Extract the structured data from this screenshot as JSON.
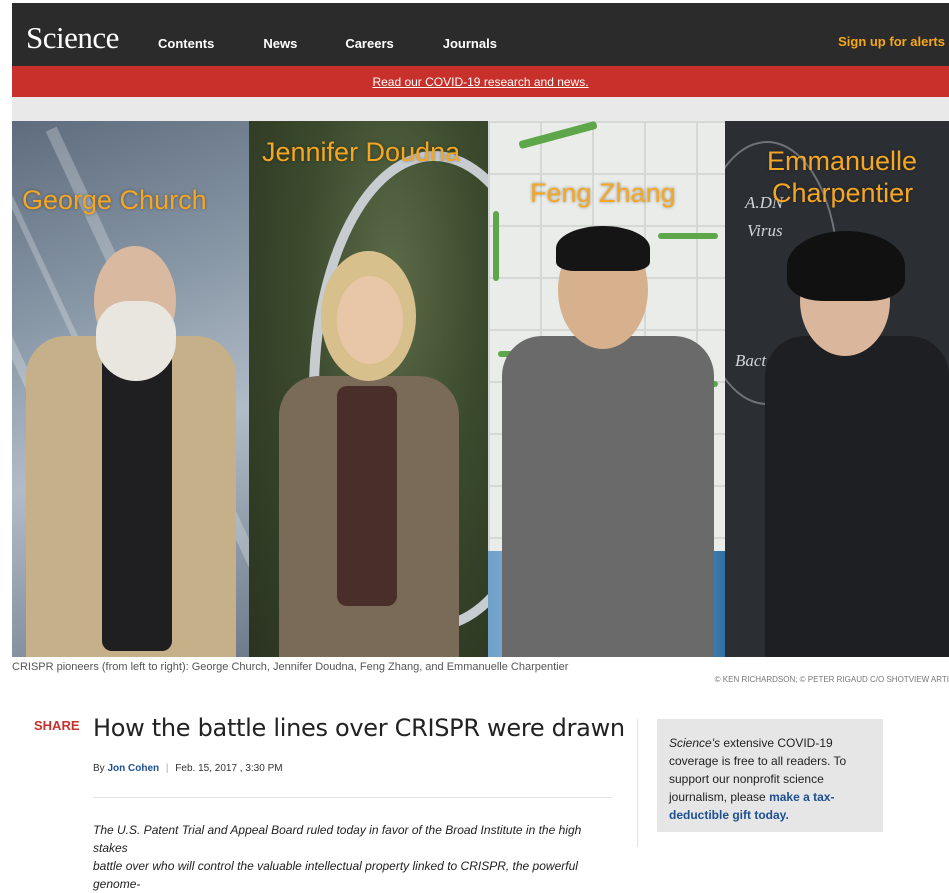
{
  "header": {
    "logo": "Science",
    "nav": [
      {
        "label": "Contents"
      },
      {
        "label": "News"
      },
      {
        "label": "Careers"
      },
      {
        "label": "Journals"
      }
    ],
    "signup_label": "Sign up for alerts"
  },
  "covid_banner": {
    "link_text": "Read our COVID-19 research and news."
  },
  "hero": {
    "labels": {
      "church": "George Church",
      "doudna": "Jennifer Doudna",
      "zhang": "Feng Zhang",
      "charpentier_1": "Emmanuelle",
      "charpentier_2": "Charpentier"
    },
    "chalk": {
      "adn": "A.DN",
      "virus": "Virus",
      "bact": "Bact"
    },
    "caption": "CRISPR pioneers (from left to right): George Church, Jennifer Doudna, Feng Zhang, and Emmanuelle Charpentier",
    "credit": "© KEN RICHARDSON; © PETER RIGAUD C/O SHOTVIEW ARTI"
  },
  "article": {
    "share_label": "SHARE",
    "headline": "How the battle lines over CRISPR were drawn",
    "by": "By",
    "author": "Jon Cohen",
    "separator": "|",
    "date": "Feb. 15, 2017 , 3:30 PM",
    "lede_line1": "The U.S. Patent Trial and Appeal Board ruled today in favor of the Broad Institute in the high stakes",
    "lede_line2": "battle over who will control the valuable intellectual property linked to CRISPR, the powerful genome-"
  },
  "promo": {
    "italic": "Science's",
    "text": " extensive COVID-19 coverage is free to all readers. To support our nonprofit science journalism, please ",
    "cta": "make a tax-deductible gift today."
  },
  "colors": {
    "header_bg": "#2b2b2b",
    "banner_red": "#c8312b",
    "accent_orange": "#f5a71b",
    "link_blue": "#1d4f91",
    "label_orange": "#f5a623"
  }
}
